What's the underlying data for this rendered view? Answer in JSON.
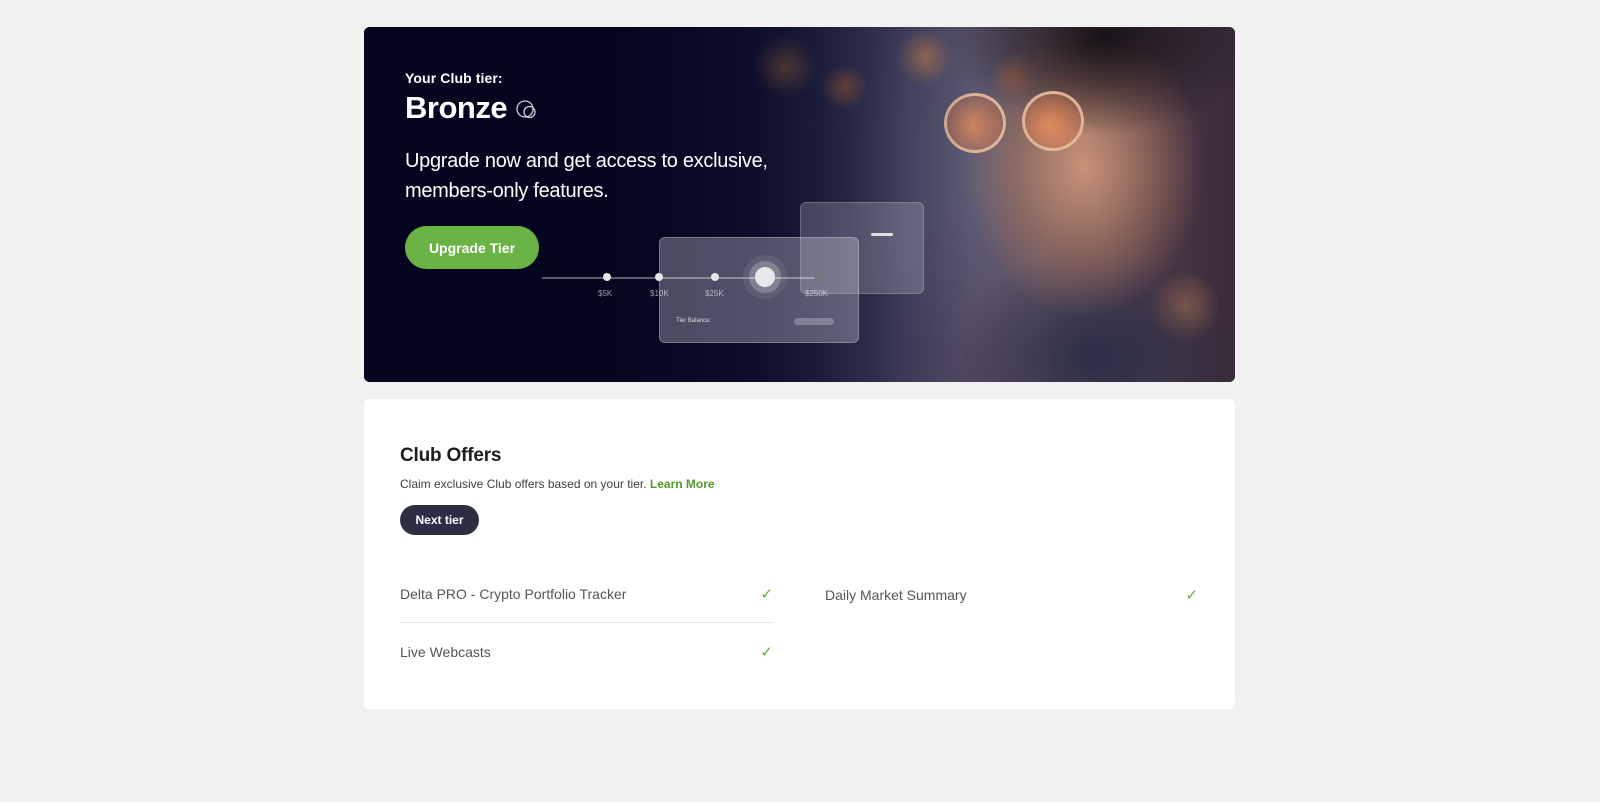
{
  "hero": {
    "tier_label": "Your Club tier:",
    "tier_name": "Bronze",
    "tier_icon": "bronze-coin-icon",
    "tagline": "Upgrade now and get access to exclusive, members-only features.",
    "upgrade_button": "Upgrade Tier",
    "tier_ticks": [
      "$5K",
      "$10K",
      "$25K",
      "$250K"
    ],
    "card_label": "Tier Balance:"
  },
  "offers": {
    "title": "Club Offers",
    "description": "Claim exclusive Club offers based on your tier.",
    "learn_more": "Learn More",
    "next_tier_button": "Next tier",
    "items": [
      {
        "label": "Delta PRO - Crypto Portfolio Tracker",
        "included": true
      },
      {
        "label": "Daily Market Summary",
        "included": true
      },
      {
        "label": "Live Webcasts",
        "included": true
      }
    ]
  },
  "colors": {
    "accent_green": "#6ab445",
    "hero_bg": "#07082a",
    "dark_button": "#2b2f45",
    "page_bg": "#f1f1f1"
  }
}
